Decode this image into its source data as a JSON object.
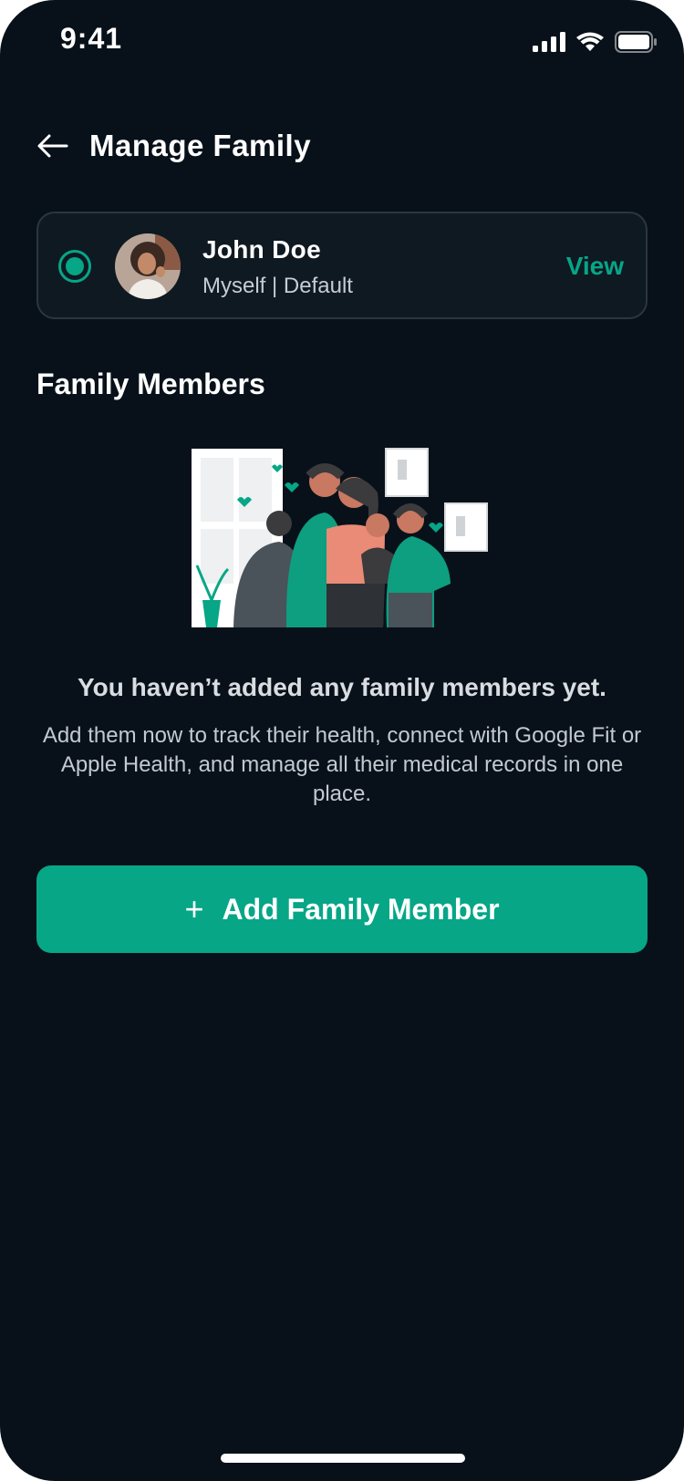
{
  "status_bar": {
    "time": "9:41"
  },
  "header": {
    "title": "Manage Family"
  },
  "profile": {
    "name": "John Doe",
    "subtitle": "Myself | Default",
    "view_label": "View"
  },
  "section": {
    "title": "Family Members"
  },
  "empty_state": {
    "title": "You haven’t added any family members yet.",
    "body": "Add them now to track their health, connect with Google Fit or Apple Health, and manage all their medical records in one place."
  },
  "actions": {
    "add_label": "Add Family Member",
    "add_icon": "+"
  },
  "colors": {
    "accent": "#06a687",
    "background": "#08111a",
    "card": "#0f1922"
  },
  "icons": [
    "signal-icon",
    "wifi-icon",
    "battery-icon",
    "back-arrow-icon",
    "plus-icon"
  ]
}
